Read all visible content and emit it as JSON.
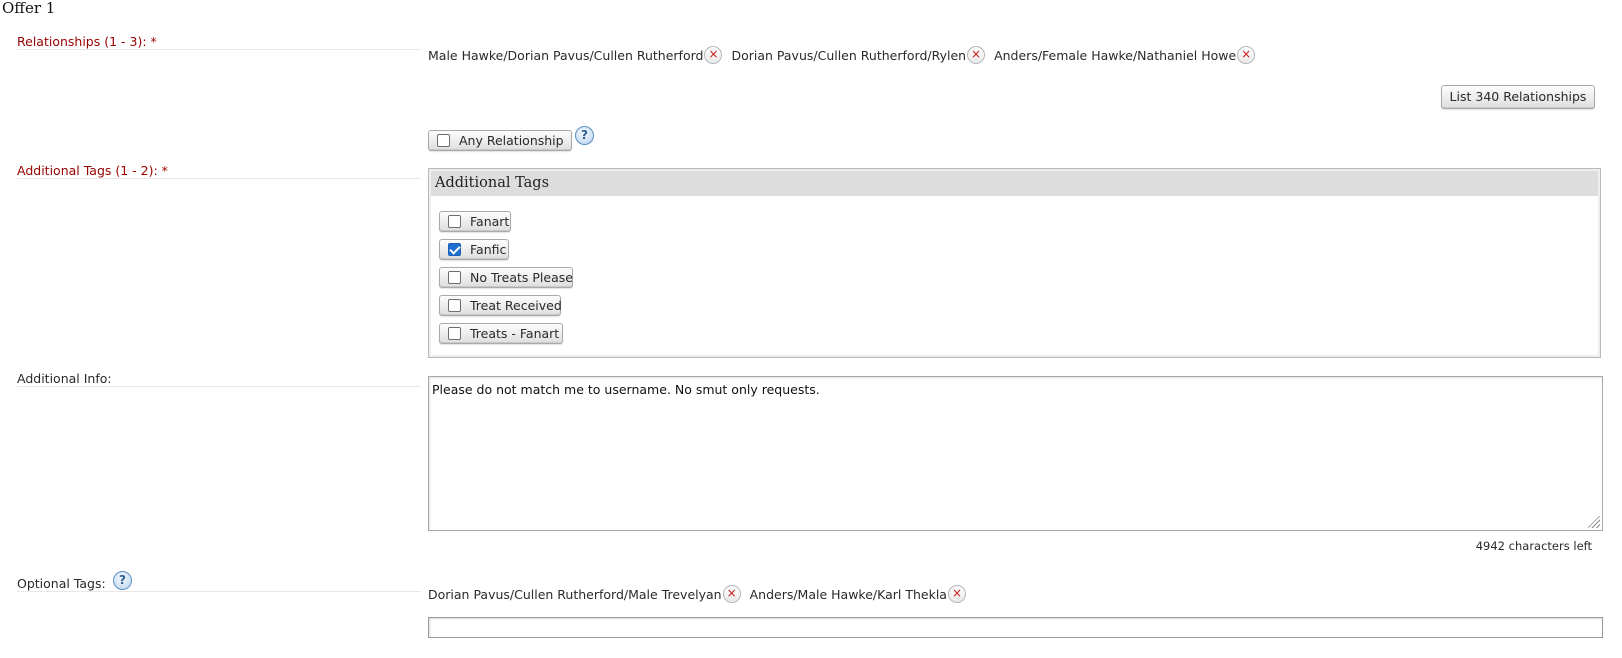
{
  "offer": {
    "title": "Offer 1"
  },
  "relationships": {
    "label": "Relationships (1 - 3): *",
    "tags": [
      "Male Hawke/Dorian Pavus/Cullen Rutherford",
      "Dorian Pavus/Cullen Rutherford/Rylen",
      "Anders/Female Hawke/Nathaniel Howe"
    ],
    "remove_glyph": "×",
    "list_button": "List 340 Relationships",
    "any_label": "Any Relationship",
    "any_checked": false
  },
  "additional_tags": {
    "label": "Additional Tags (1 - 2): *",
    "header": "Additional Tags",
    "options": [
      {
        "label": "Fanart",
        "checked": false
      },
      {
        "label": "Fanfic",
        "checked": true
      },
      {
        "label": "No Treats Please",
        "checked": false
      },
      {
        "label": "Treat Received",
        "checked": false
      },
      {
        "label": "Treats - Fanart",
        "checked": false
      }
    ]
  },
  "additional_info": {
    "label": "Additional Info:",
    "value": "Please do not match me to username. No smut only requests.",
    "chars_left": "4942 characters left"
  },
  "optional_tags": {
    "label": "Optional Tags:",
    "tags": [
      "Dorian Pavus/Cullen Rutherford/Male Trevelyan",
      "Anders/Male Hawke/Karl Thekla"
    ],
    "input_value": ""
  },
  "help": {
    "glyph": "?"
  },
  "icons": {
    "remove": "remove-x-icon",
    "help": "question-help-icon",
    "check": "checkmark-icon",
    "grip": "resize-grip-icon"
  },
  "colors": {
    "required_label": "#990000",
    "remove_x": "#c81a1a",
    "checkbox_checked": "#1f6fd1",
    "help_icon": "#5e8fc2"
  }
}
